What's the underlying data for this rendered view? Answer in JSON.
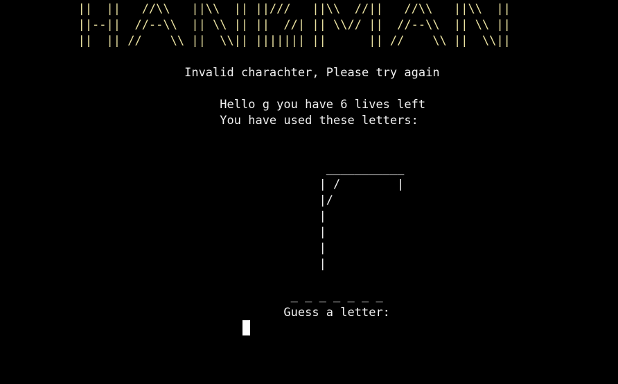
{
  "banner": {
    "lines": [
      "           ||  ||   //\\\\   ||\\\\  || ||///   ||\\\\  //||   //\\\\   ||\\\\  ||",
      "           ||--||  //--\\\\  || \\\\ || ||  //| || \\\\// ||  //--\\\\  || \\\\ ||",
      "           ||  || //    \\\\ ||  \\\\|| ||||||| ||      || //    \\\\ ||  \\\\||"
    ]
  },
  "messages": {
    "error": "                          Invalid charachter, Please try again",
    "greeting": "                               Hello g you have 6 lives left",
    "used_letters": "                               You have used these letters:"
  },
  "gallows": {
    "lines": [
      "                                              ___________",
      "                                             | /        |",
      "                                             |/",
      "                                             |",
      "                                             |",
      "                                             |",
      "                                             |"
    ]
  },
  "word": {
    "blanks": "                                         _ _ _ _ _ _ _"
  },
  "prompt": {
    "label": "                                        Guess a letter:"
  }
}
